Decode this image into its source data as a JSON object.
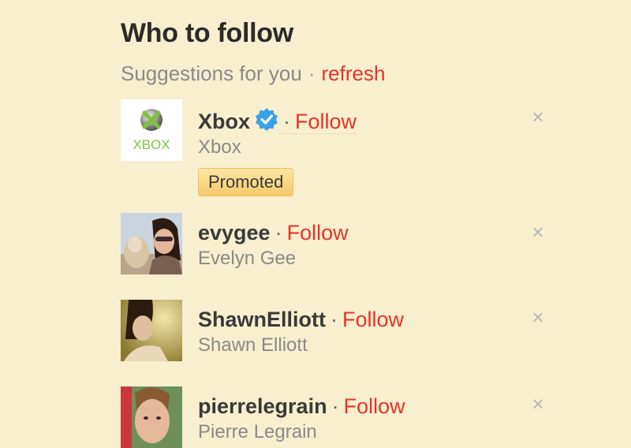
{
  "header": {
    "title": "Who to follow",
    "subtitle": "Suggestions for you",
    "separator": "·",
    "refresh_label": "refresh"
  },
  "suggestions": [
    {
      "handle": "Xbox",
      "full_name": "Xbox",
      "follow_label": "Follow",
      "verified": true,
      "promoted_label": "Promoted",
      "avatar_text": "XBOX",
      "dismiss_label": "×"
    },
    {
      "handle": "evygee",
      "full_name": "Evelyn Gee",
      "follow_label": "Follow",
      "dismiss_label": "×"
    },
    {
      "handle": "ShawnElliott",
      "full_name": "Shawn Elliott",
      "follow_label": "Follow",
      "dismiss_label": "×"
    },
    {
      "handle": "pierrelegrain",
      "full_name": "Pierre Legrain",
      "follow_label": "Follow",
      "dismiss_label": "×"
    }
  ],
  "colors": {
    "background": "#f7efce",
    "accent_red": "#e8332a",
    "verified_blue": "#3aa0e8",
    "xbox_green": "#7cc242"
  }
}
